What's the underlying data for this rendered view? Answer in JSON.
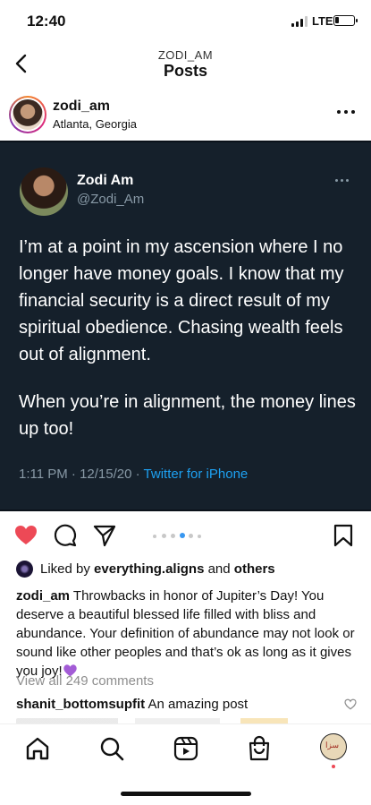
{
  "status_bar": {
    "time": "12:40",
    "network": "LTE",
    "battery_level": 0.2
  },
  "header": {
    "account": "ZODI_AM",
    "title": "Posts"
  },
  "post": {
    "username": "zodi_am",
    "location": "Atlanta, Georgia"
  },
  "tweet": {
    "name": "Zodi Am",
    "handle": "@Zodi_Am",
    "paragraph1": "I’m at a point in my ascension where I no longer have money goals. I know that my financial security is a direct result of my spiritual obedience. Chasing wealth feels out of alignment.",
    "paragraph2": "When you’re in alignment, the money lines up too!",
    "timestamp": "1:11 PM · 12/15/20 · ",
    "source": "Twitter for iPhone"
  },
  "carousel": {
    "count": 6,
    "active_index": 3
  },
  "likes": {
    "prefix": "Liked by ",
    "user": "everything.aligns",
    "middle": " and ",
    "others": "others"
  },
  "caption": {
    "username": "zodi_am",
    "text": " Throwbacks in honor of Jupiter’s Day! You deserve a beautiful blessed life filled with bliss and abundance. Your definition of abundance may not look or sound like other peoples and that’s ok as long as it gives you joy!"
  },
  "comments": {
    "view_all": "View all 249 comments",
    "first_user": "shanit_bottomsupfit",
    "first_text": " An amazing post"
  },
  "colors": {
    "like_red": "#ed4956",
    "tweet_bg": "#15202b",
    "twitter_blue": "#1da1f2",
    "emoji_purple": "#a35cd6",
    "carousel_active": "#3897f0"
  },
  "icons": [
    "back-chevron",
    "more-dots",
    "heart",
    "comment",
    "share",
    "save",
    "home",
    "search",
    "reels",
    "shop",
    "profile"
  ]
}
